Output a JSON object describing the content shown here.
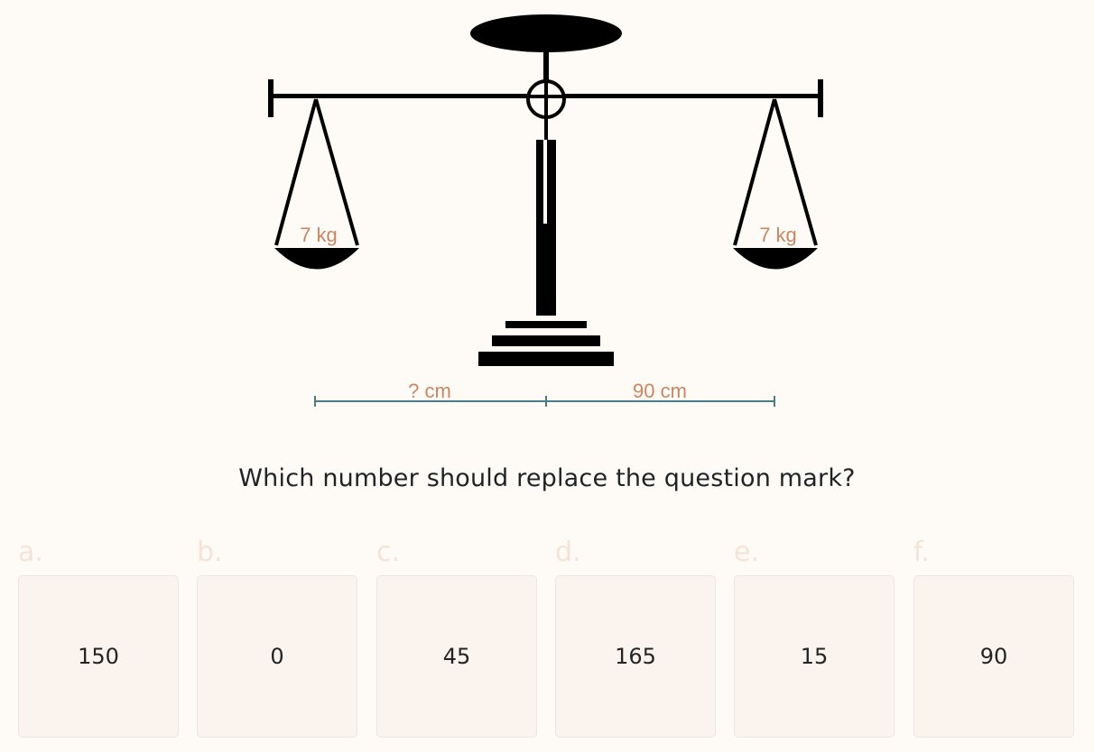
{
  "puzzle": {
    "left_weight": "7 kg",
    "right_weight": "7 kg",
    "left_distance": "? cm",
    "right_distance": "90 cm",
    "question": "Which number should replace the question mark?"
  },
  "options": [
    {
      "letter": "a.",
      "value": "150"
    },
    {
      "letter": "b.",
      "value": "0"
    },
    {
      "letter": "c.",
      "value": "45"
    },
    {
      "letter": "d.",
      "value": "165"
    },
    {
      "letter": "e.",
      "value": "15"
    },
    {
      "letter": "f.",
      "value": "90"
    }
  ],
  "colors": {
    "background": "#fefbf7",
    "scale": "#000000",
    "weight_label": "#c98660",
    "measure_line": "#4a7c86",
    "option_letter": "#f6e3d6",
    "option_box": "#fbf3ee"
  }
}
